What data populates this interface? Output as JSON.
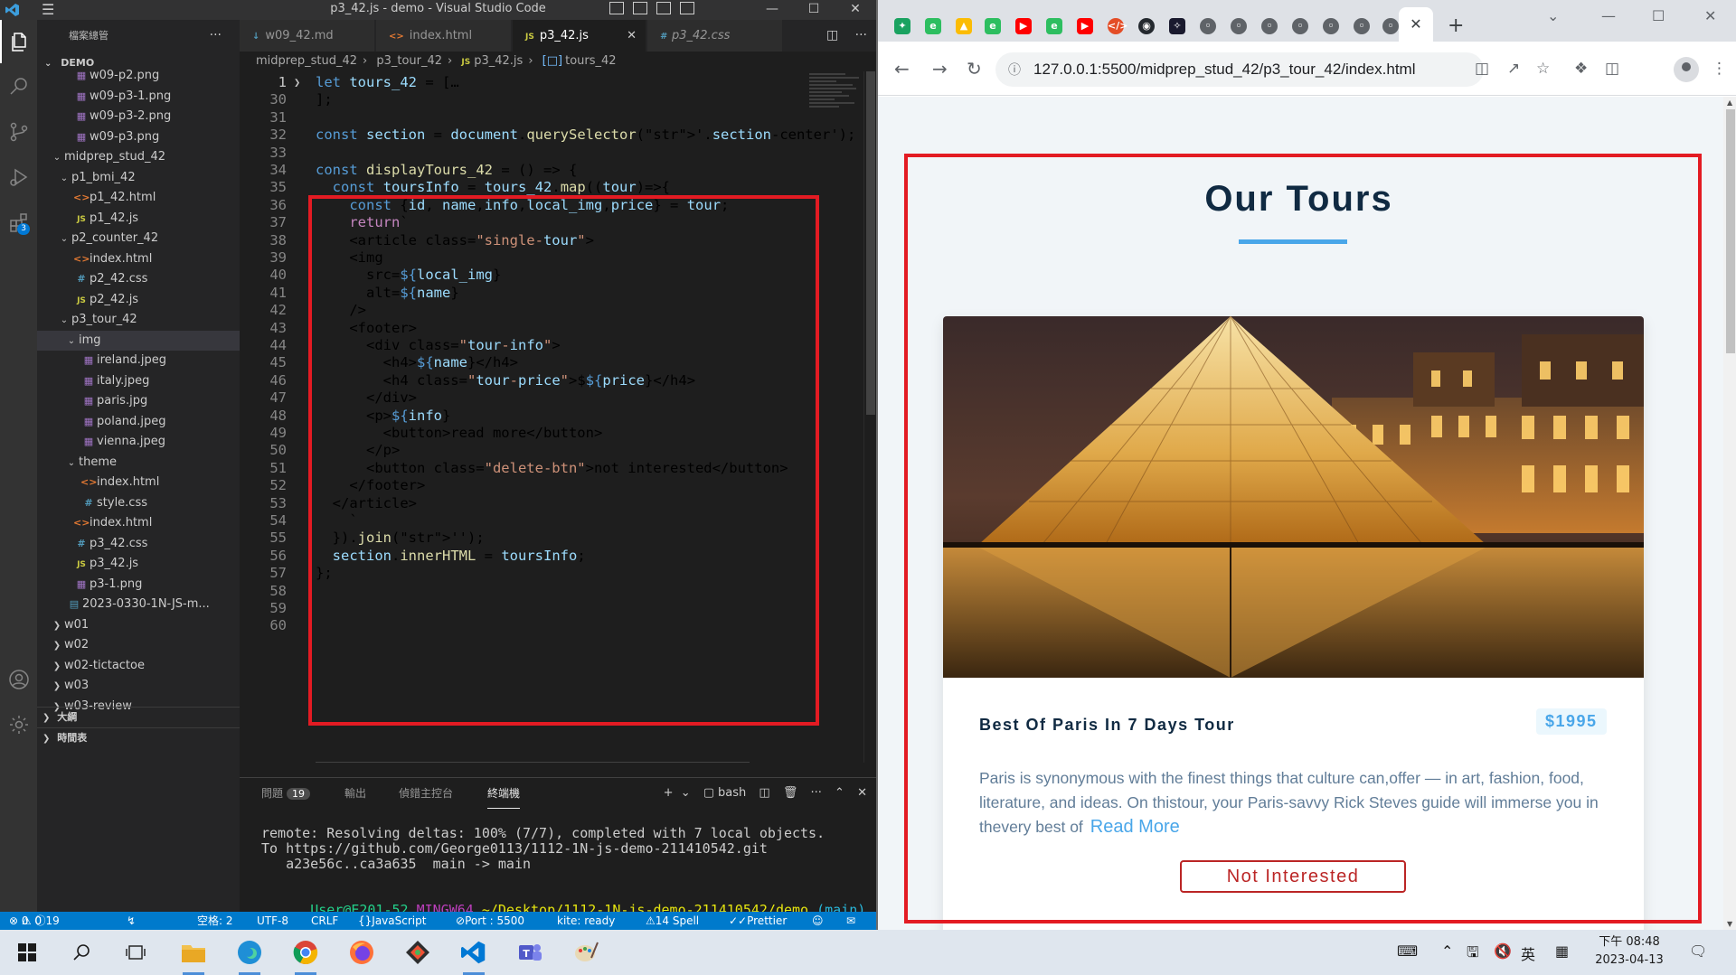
{
  "vscode": {
    "window_title": "p3_42.js - demo - Visual Studio Code",
    "explorer_title": "檔案總管",
    "explorer_more": "···",
    "workspace": "DEMO",
    "tree": [
      {
        "label": "w09-p2.png",
        "type": "png",
        "depth": 3,
        "chev": ""
      },
      {
        "label": "w09-p3-1.png",
        "type": "png",
        "depth": 3,
        "chev": ""
      },
      {
        "label": "w09-p3-2.png",
        "type": "png",
        "depth": 3,
        "chev": ""
      },
      {
        "label": "w09-p3.png",
        "type": "png",
        "depth": 3,
        "chev": ""
      },
      {
        "label": "midprep_stud_42",
        "type": "folder",
        "depth": 1,
        "chev": "v"
      },
      {
        "label": "p1_bmi_42",
        "type": "folder",
        "depth": 2,
        "chev": "v"
      },
      {
        "label": "p1_42.html",
        "type": "html",
        "depth": 3,
        "chev": ""
      },
      {
        "label": "p1_42.js",
        "type": "js",
        "depth": 3,
        "chev": ""
      },
      {
        "label": "p2_counter_42",
        "type": "folder",
        "depth": 2,
        "chev": "v"
      },
      {
        "label": "index.html",
        "type": "html",
        "depth": 3,
        "chev": ""
      },
      {
        "label": "p2_42.css",
        "type": "css",
        "depth": 3,
        "chev": ""
      },
      {
        "label": "p2_42.js",
        "type": "js",
        "depth": 3,
        "chev": ""
      },
      {
        "label": "p3_tour_42",
        "type": "folder",
        "depth": 2,
        "chev": "v"
      },
      {
        "label": "img",
        "type": "folder",
        "depth": 3,
        "chev": "v",
        "selected": true
      },
      {
        "label": "ireland.jpeg",
        "type": "jpg",
        "depth": 4,
        "chev": ""
      },
      {
        "label": "italy.jpeg",
        "type": "jpg",
        "depth": 4,
        "chev": ""
      },
      {
        "label": "paris.jpg",
        "type": "jpg",
        "depth": 4,
        "chev": ""
      },
      {
        "label": "poland.jpeg",
        "type": "jpg",
        "depth": 4,
        "chev": ""
      },
      {
        "label": "vienna.jpeg",
        "type": "jpg",
        "depth": 4,
        "chev": ""
      },
      {
        "label": "theme",
        "type": "folder",
        "depth": 3,
        "chev": "v"
      },
      {
        "label": "index.html",
        "type": "html",
        "depth": 4,
        "chev": ""
      },
      {
        "label": "style.css",
        "type": "css",
        "depth": 4,
        "chev": ""
      },
      {
        "label": "index.html",
        "type": "html",
        "depth": 3,
        "chev": ""
      },
      {
        "label": "p3_42.css",
        "type": "css",
        "depth": 3,
        "chev": ""
      },
      {
        "label": "p3_42.js",
        "type": "js",
        "depth": 3,
        "chev": ""
      },
      {
        "label": "p3-1.png",
        "type": "png",
        "depth": 3,
        "chev": ""
      },
      {
        "label": "2023-0330-1N-JS-m...",
        "type": "md",
        "depth": 2,
        "chev": ""
      },
      {
        "label": "w01",
        "type": "folder",
        "depth": 1,
        "chev": ">"
      },
      {
        "label": "w02",
        "type": "folder",
        "depth": 1,
        "chev": ">"
      },
      {
        "label": "w02-tictactoe",
        "type": "folder",
        "depth": 1,
        "chev": ">"
      },
      {
        "label": "w03",
        "type": "folder",
        "depth": 1,
        "chev": ">"
      },
      {
        "label": "w03-review",
        "type": "folder",
        "depth": 1,
        "chev": ">"
      }
    ],
    "outline_label": "大綱",
    "timeline_label": "時間表",
    "extensions_badge": "3",
    "tabs": [
      {
        "label": "w09_42.md",
        "icon": "md"
      },
      {
        "label": "index.html",
        "icon": "html"
      },
      {
        "label": "p3_42.js",
        "icon": "js",
        "active": true
      },
      {
        "label": "p3_42.css",
        "icon": "css"
      }
    ],
    "tab_close": "✕",
    "breadcrumb": [
      "midprep_stud_42",
      "p3_tour_42",
      "p3_42.js",
      "tours_42"
    ],
    "code_lines": [
      {
        "n": "1",
        "text": "let tours_42 = […"
      },
      {
        "n": "30",
        "text": "];"
      },
      {
        "n": "31",
        "text": ""
      },
      {
        "n": "32",
        "text": "const section = document.querySelector('.section-center');"
      },
      {
        "n": "33",
        "text": ""
      },
      {
        "n": "34",
        "text": "const displayTours_42 = () => {"
      },
      {
        "n": "35",
        "text": "  const toursInfo = tours_42.map((tour)=>{"
      },
      {
        "n": "36",
        "text": "    const {id, name,info,local_img,price} = tour;"
      },
      {
        "n": "37",
        "text": "    return`"
      },
      {
        "n": "38",
        "text": "    <article class=\"single-tour\">"
      },
      {
        "n": "39",
        "text": "    <img"
      },
      {
        "n": "40",
        "text": "      src=${local_img}"
      },
      {
        "n": "41",
        "text": "      alt=${name}"
      },
      {
        "n": "42",
        "text": "    />"
      },
      {
        "n": "43",
        "text": "    <footer>"
      },
      {
        "n": "44",
        "text": "      <div class=\"tour-info\">"
      },
      {
        "n": "45",
        "text": "        <h4>${name}</h4>"
      },
      {
        "n": "46",
        "text": "        <h4 class=\"tour-price\">$${price}</h4>"
      },
      {
        "n": "47",
        "text": "      </div>"
      },
      {
        "n": "48",
        "text": "      <p>${info}"
      },
      {
        "n": "49",
        "text": "        <button>read more</button>"
      },
      {
        "n": "50",
        "text": "      </p>"
      },
      {
        "n": "51",
        "text": "      <button class=\"delete-btn\">not interested</button>"
      },
      {
        "n": "52",
        "text": "    </footer>"
      },
      {
        "n": "53",
        "text": "  </article>"
      },
      {
        "n": "54",
        "text": "    `"
      },
      {
        "n": "55",
        "text": "  }).join('');"
      },
      {
        "n": "56",
        "text": "  section.innerHTML = toursInfo;"
      },
      {
        "n": "57",
        "text": "};"
      },
      {
        "n": "58",
        "text": ""
      },
      {
        "n": "59",
        "text": ""
      },
      {
        "n": "60",
        "text": ""
      }
    ],
    "panel": {
      "tabs": [
        "問題",
        "輸出",
        "偵錯主控台",
        "終端機"
      ],
      "problems_count": "19",
      "active_tab": "終端機",
      "shell": "bash",
      "terminal": [
        "remote: Resolving deltas: 100% (7/7), completed with 7 local objects.",
        "To https://github.com/George0113/1112-1N-js-demo-211410542.git",
        "   a23e56c..ca3a635  main -> main"
      ],
      "prompt_user": "User@E201-52",
      "prompt_shell": "MINGW64",
      "prompt_path": "~/Desktop/1112-1N-js-demo-211410542/demo",
      "prompt_branch": "(main)"
    },
    "status": {
      "errors": "0",
      "warnings": "0",
      "info": "19",
      "spaces": "空格: 2",
      "encoding": "UTF-8",
      "eol": "CRLF",
      "language": "JavaScript",
      "port": "Port : 5500",
      "kite": "kite: ready",
      "spell": "14 Spell",
      "prettier": "Prettier"
    }
  },
  "chrome": {
    "url": "127.0.0.1:5500/midprep_stud_42/p3_tour_42/index.html",
    "page": {
      "title": "Our Tours",
      "tour": {
        "name": "Best Of Paris In 7 Days Tour",
        "price": "$1995",
        "info": "Paris is synonymous with the finest things that culture can,offer — in art, fashion, food, literature, and ideas. On thistour, your Paris-savvy Rick Steves guide will immerse you in thevery best of",
        "read_more": "Read More",
        "not_interested": "Not Interested"
      }
    }
  },
  "taskbar": {
    "ime": "英",
    "time": "下午 08:48",
    "date": "2023-04-13"
  },
  "colors": {
    "vscode_blue": "#007acc",
    "highlight_red": "#e31b23",
    "tour_blue": "#49a6e9",
    "tour_dark": "#102a42",
    "delete_red": "#bb2525"
  }
}
